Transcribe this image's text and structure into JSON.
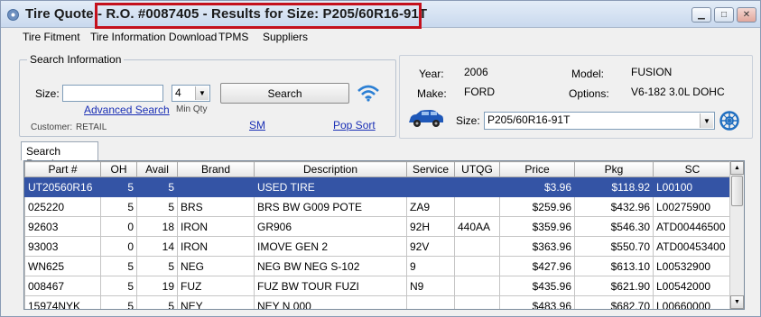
{
  "window": {
    "title_prefix": "Tire Quote - ",
    "title_highlight": "R.O. #0087405 - Results for Size: P205/60R16-91T",
    "controls": {
      "minimize": "▁",
      "maximize": "□",
      "close": "✕"
    }
  },
  "menu": [
    "Tire Fitment",
    "Tire Information Download",
    "TPMS",
    "Suppliers"
  ],
  "search": {
    "legend": "Search Information",
    "size_label": "Size:",
    "size_value": "",
    "qty_value": "4",
    "min_qty_label": "Min Qty",
    "search_button": "Search",
    "advanced_link": "Advanced Search",
    "customer_label": "Customer:",
    "customer_value": "RETAIL",
    "sm_link": "SM",
    "popsort_link": "Pop Sort"
  },
  "vehicle": {
    "year_label": "Year:",
    "year": "2006",
    "make_label": "Make:",
    "make": "FORD",
    "model_label": "Model:",
    "model": "FUSION",
    "options_label": "Options:",
    "options": "V6-182  3.0L DOHC",
    "size_label": "Size:",
    "size_value": "P205/60R16-91T"
  },
  "results": {
    "tab_label": "Search Results",
    "columns": [
      "Part #",
      "OH",
      "Avail",
      "Brand",
      "Description",
      "Service",
      "UTQG",
      "Price",
      "Pkg",
      "SC"
    ],
    "rows": [
      [
        "UT20560R16",
        "5",
        "5",
        "",
        "USED TIRE",
        "",
        "",
        "$3.96",
        "$118.92",
        "L00100"
      ],
      [
        "025220",
        "5",
        "5",
        "BRS",
        "BRS BW G009 POTE",
        "ZA9",
        "",
        "$259.96",
        "$432.96",
        "L00275900"
      ],
      [
        "92603",
        "0",
        "18",
        "IRON",
        "GR906",
        "92H",
        "440AA",
        "$359.96",
        "$546.30",
        "ATD00446500"
      ],
      [
        "93003",
        "0",
        "14",
        "IRON",
        "IMOVE GEN 2",
        "92V",
        "",
        "$363.96",
        "$550.70",
        "ATD00453400"
      ],
      [
        "WN625",
        "5",
        "5",
        "NEG",
        "NEG BW NEG S-102",
        "9",
        "",
        "$427.96",
        "$613.10",
        "L00532900"
      ],
      [
        "008467",
        "5",
        "19",
        "FUZ",
        "FUZ BW TOUR FUZI",
        "N9",
        "",
        "$435.96",
        "$621.90",
        "L00542000"
      ],
      [
        "15974NYK",
        "5",
        "5",
        "NEY",
        "NEY N 000",
        "",
        "",
        "$483.96",
        "$682.70",
        "L00660000"
      ]
    ],
    "selected_row": 0
  },
  "colors": {
    "selection": "#3454a5",
    "highlight_box": "#c4101c",
    "link": "#1a2fb5"
  }
}
